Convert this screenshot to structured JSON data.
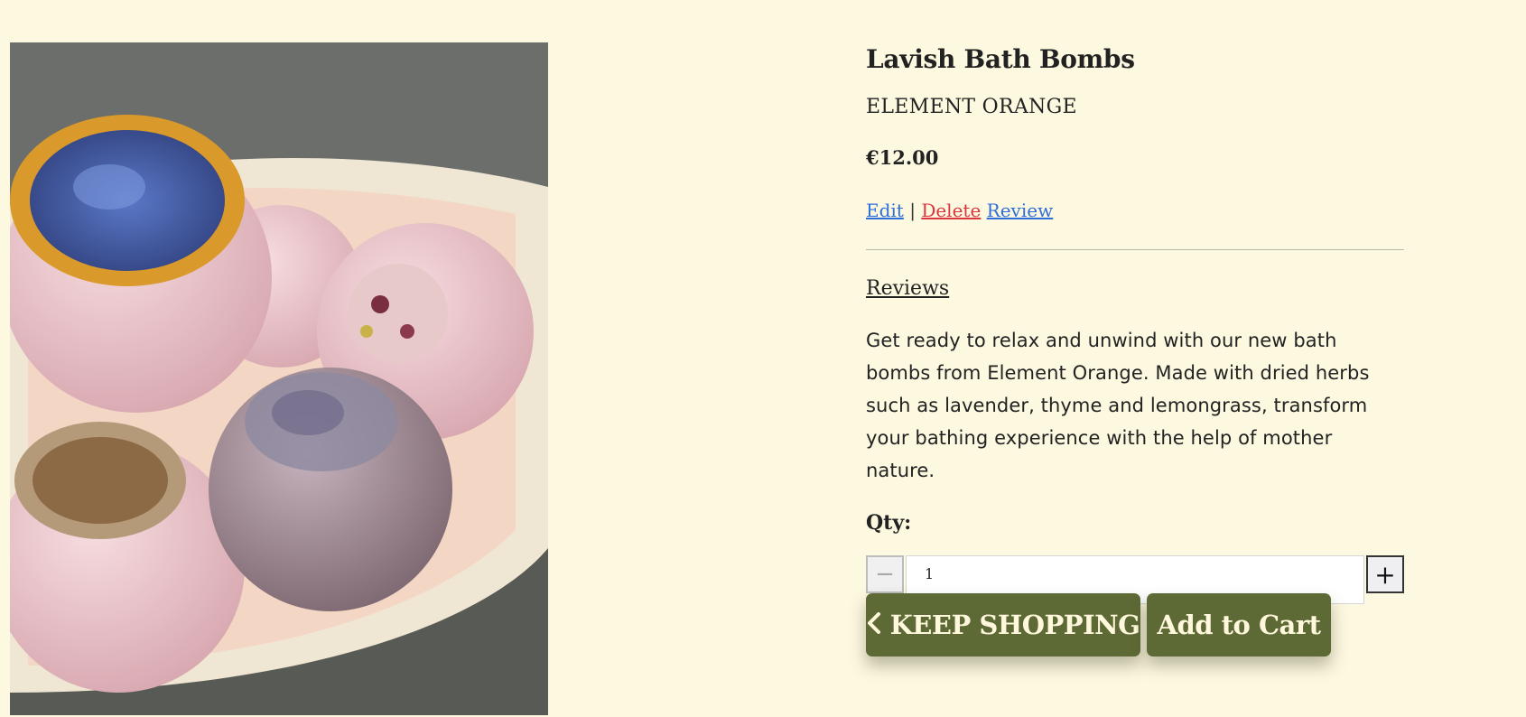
{
  "product": {
    "title": "Lavish Bath Bombs",
    "brand": "ELEMENT ORANGE",
    "price": "€12.00",
    "description": "Get ready to relax and unwind with our new bath bombs from Element Orange. Made with dried herbs such as lavender, thyme and lemongrass, transform your bathing experience with the help of mother nature."
  },
  "actions": {
    "edit_label": "Edit",
    "separator": "|",
    "delete_label": "Delete",
    "review_label": "Review"
  },
  "reviews": {
    "link_label": "Reviews"
  },
  "quantity": {
    "label": "Qty:",
    "value": "1",
    "minus_glyph": "−",
    "plus_glyph": "+"
  },
  "buttons": {
    "keep_shopping_label": "KEEP SHOPPING",
    "add_to_cart_label": "Add to Cart"
  },
  "colors": {
    "page_bg": "#fdf8e0",
    "button_bg": "#5d6a35",
    "link_blue": "#2f6ed8",
    "link_red": "#d9363e"
  },
  "icons": {
    "keep_shopping_icon": "chevron-left-icon"
  }
}
